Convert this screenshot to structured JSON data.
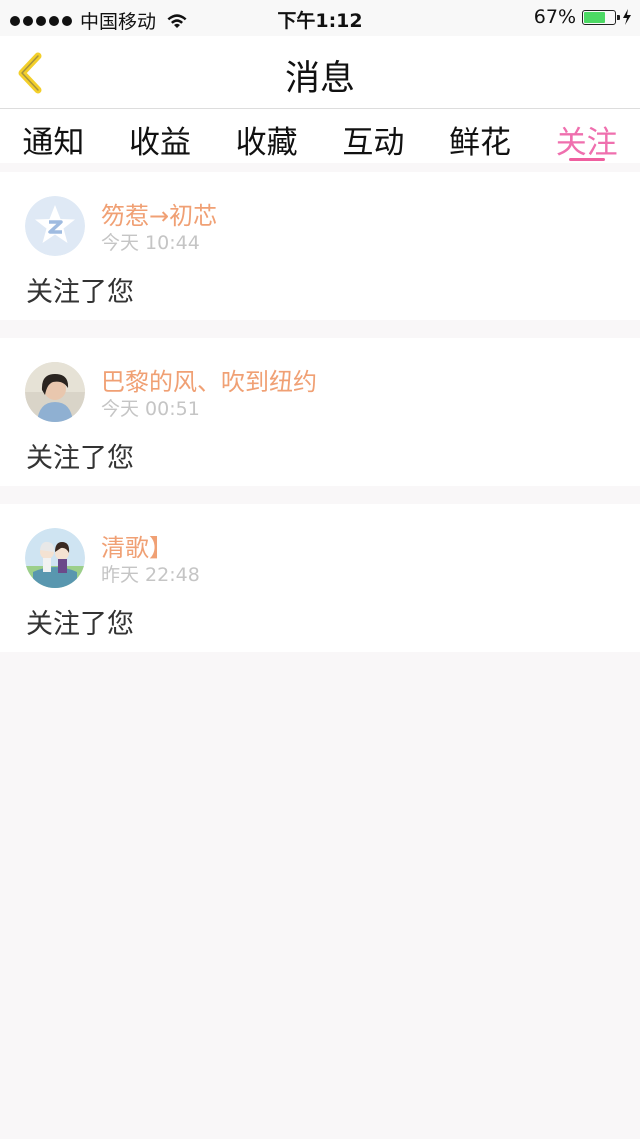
{
  "status_bar": {
    "carrier": "中国移动",
    "time": "下午1:12",
    "battery_percent": "67%",
    "battery_level": 0.67
  },
  "nav": {
    "title": "消息"
  },
  "tabs": [
    {
      "label": "通知"
    },
    {
      "label": "收益"
    },
    {
      "label": "收藏"
    },
    {
      "label": "互动"
    },
    {
      "label": "鲜花"
    },
    {
      "label": "关注",
      "active": true
    }
  ],
  "notifications": [
    {
      "username": "笏惹→初芯",
      "time": "今天 10:44",
      "message": "关注了您"
    },
    {
      "username": "巴黎的风、吹到纽约",
      "time": "今天 00:51",
      "message": "关注了您"
    },
    {
      "username": "清歌】",
      "time": "昨天 22:48",
      "message": "关注了您"
    }
  ],
  "colors": {
    "accent": "#ef6fae",
    "username": "#f0a074",
    "back_icon": "#f3cf2a"
  }
}
